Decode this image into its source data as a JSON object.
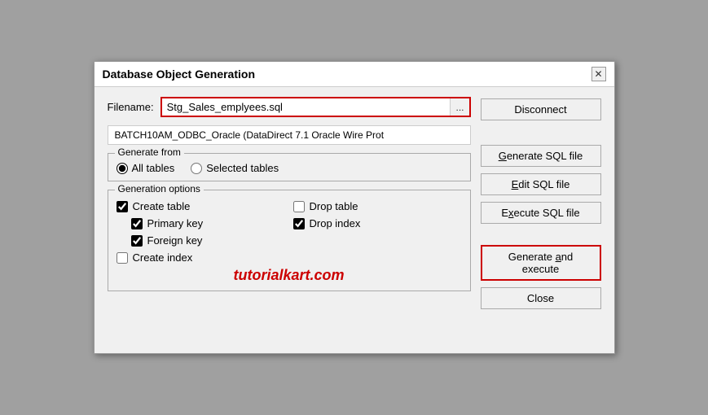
{
  "dialog": {
    "title": "Database Object Generation",
    "close_label": "✕"
  },
  "filename": {
    "label": "Filename:",
    "value": "Stg_Sales_emplyees.sql",
    "browse_label": "..."
  },
  "connection": {
    "text": "BATCH10AM_ODBC_Oracle (DataDirect 7.1 Oracle Wire Prot"
  },
  "generate_from": {
    "legend": "Generate from",
    "options": [
      {
        "label": "All tables",
        "checked": true
      },
      {
        "label": "Selected tables",
        "checked": false
      }
    ]
  },
  "generation_options": {
    "legend": "Generation options",
    "checkboxes": [
      {
        "label": "Create table",
        "checked": true,
        "indent": false
      },
      {
        "label": "Drop table",
        "checked": false,
        "indent": false
      },
      {
        "label": "Primary key",
        "checked": true,
        "indent": true
      },
      {
        "label": "Drop index",
        "checked": true,
        "indent": false
      },
      {
        "label": "Foreign key",
        "checked": true,
        "indent": true
      },
      {
        "label": "Create index",
        "checked": false,
        "indent": false
      }
    ]
  },
  "watermark": {
    "text": "tutorialkart.com"
  },
  "buttons": {
    "disconnect": "Disconnect",
    "generate_sql": "Generate SQL file",
    "edit_sql": "Edit SQL file",
    "execute_sql": "Execute SQL file",
    "generate_execute": "Generate and execute",
    "close": "Close"
  }
}
